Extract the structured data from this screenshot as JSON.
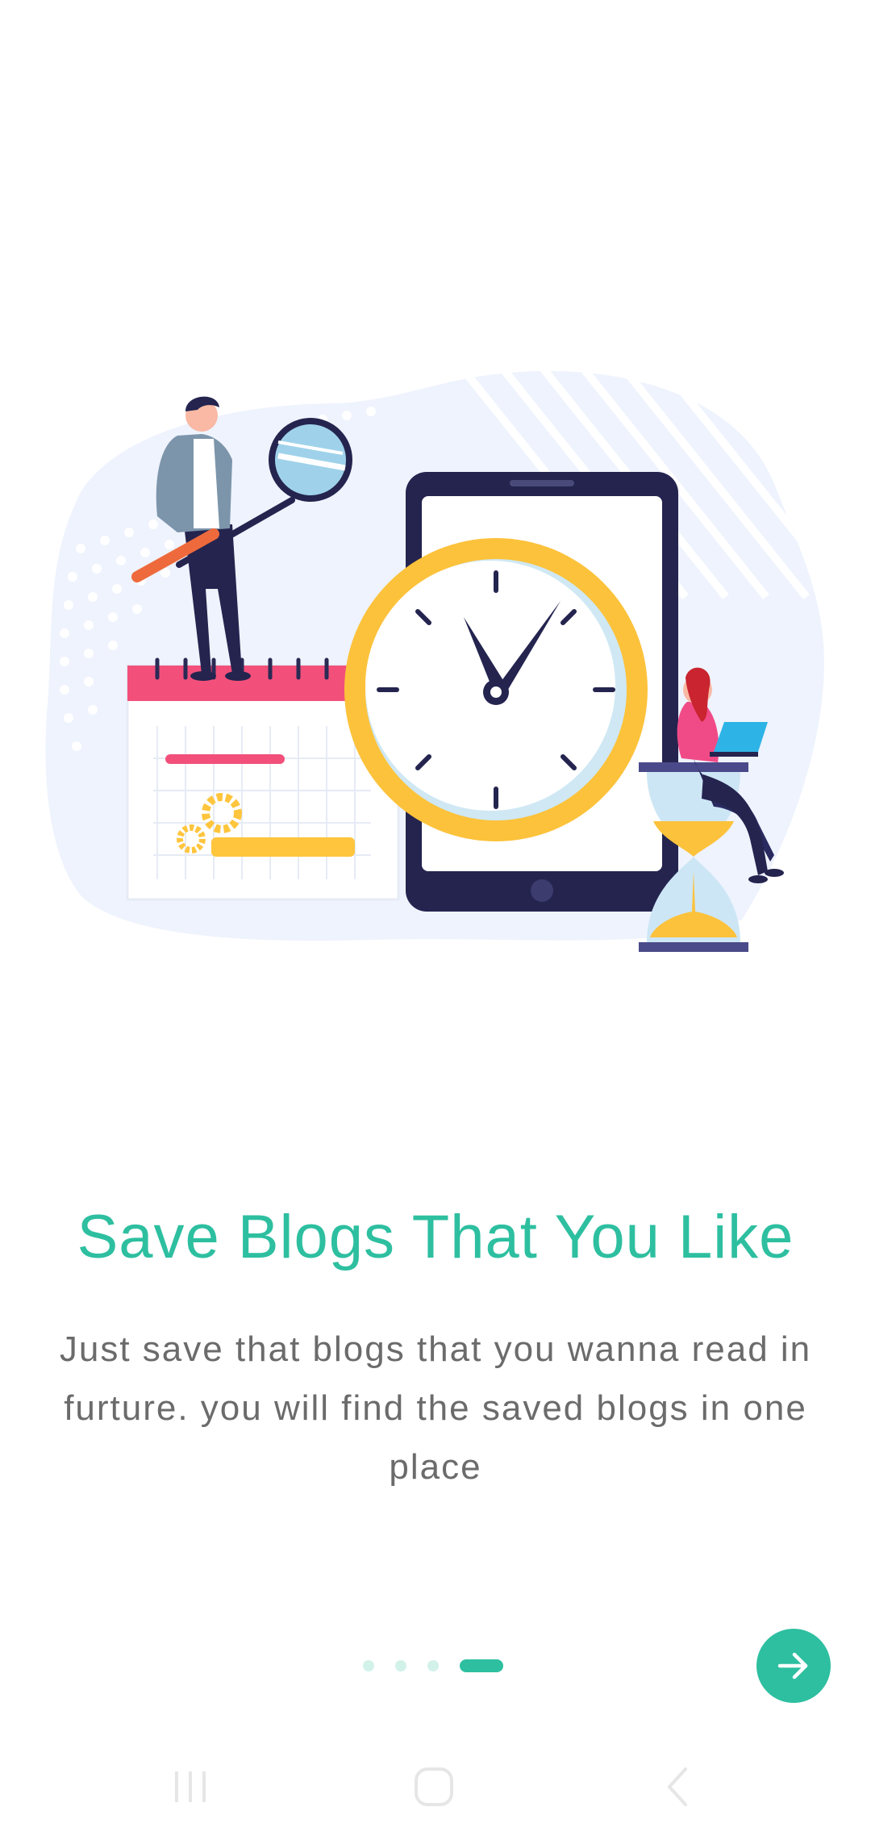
{
  "onboarding": {
    "title": "Save Blogs That You Like",
    "description": "Just save that blogs that you wanna read in furture. you will find the saved blogs in one place",
    "page_indicator": {
      "total": 4,
      "current": 4
    }
  },
  "colors": {
    "accent": "#2dbfa0",
    "text_secondary": "#6b6b6b",
    "dot_inactive": "#c3ece1",
    "nav_icon": "#e6e6e6"
  },
  "icons": {
    "next": "arrow-right-icon",
    "nav_recents": "recents-icon",
    "nav_home": "home-icon",
    "nav_back": "back-icon"
  }
}
